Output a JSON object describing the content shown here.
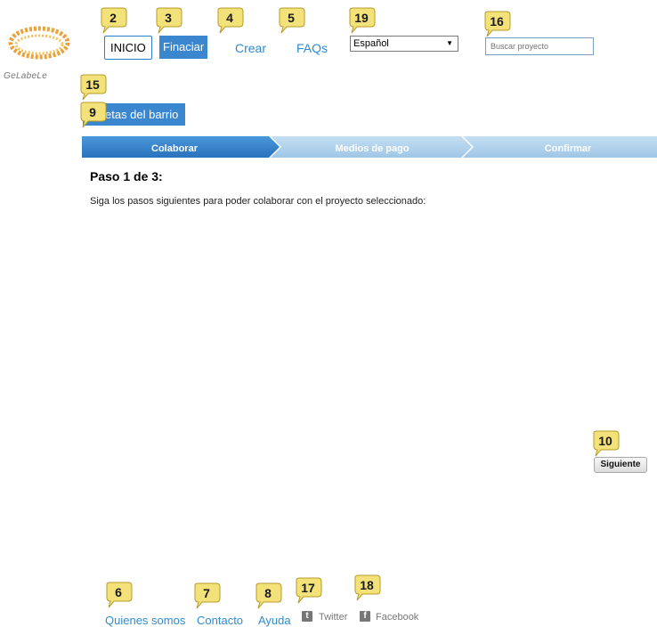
{
  "logo": {
    "text": "GeLabeLe"
  },
  "nav": {
    "home": "INICIO",
    "finance": "Finaciar",
    "create": "Crear",
    "faqs": "FAQs"
  },
  "language": {
    "selected": "Español"
  },
  "search": {
    "placeholder": "Buscar proyecto"
  },
  "project": {
    "title_visible": "etas del barrio"
  },
  "steps": [
    {
      "label": "Colaborar",
      "active": true
    },
    {
      "label": "Medios de pago",
      "active": false
    },
    {
      "label": "Confirmar",
      "active": false
    }
  ],
  "content": {
    "heading": "Paso 1 de 3:",
    "description": "Siga los pasos siguientes para poder colaborar con el proyecto seleccionado:",
    "next_button": "Siguiente"
  },
  "footer": {
    "about": "Quienes somos",
    "contact": "Contacto",
    "help": "Ayuda",
    "twitter": "Twitter",
    "facebook": "Facebook"
  },
  "callouts": {
    "c2": "2",
    "c3": "3",
    "c4": "4",
    "c5": "5",
    "c19": "19",
    "c16": "16",
    "c15": "15",
    "c9": "9",
    "c10": "10",
    "c6": "6",
    "c7": "7",
    "c8": "8",
    "c17": "17",
    "c18": "18"
  },
  "colors": {
    "accent": "#3a86cf",
    "link": "#2f8bd0",
    "step_inactive": "#a9cdea",
    "callout": "#f3e27a"
  }
}
